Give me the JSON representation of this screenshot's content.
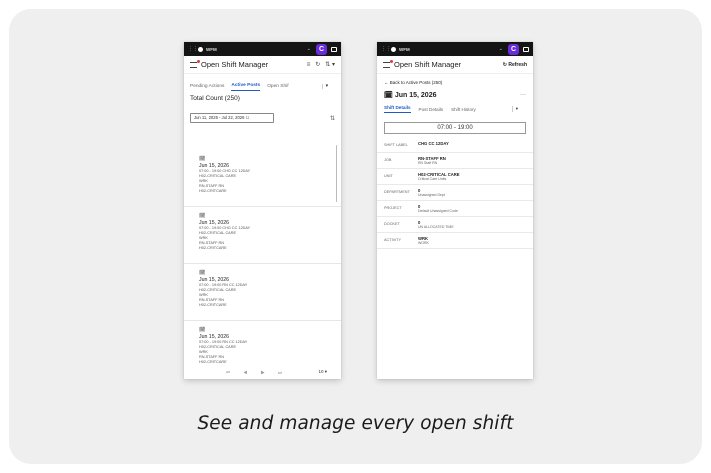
{
  "caption": "See and manage every open shift",
  "phone1": {
    "topbar": {
      "app": "WFM"
    },
    "header": {
      "title": "Open Shift Manager"
    },
    "tabs": [
      "Pending Actions",
      "Active Posts",
      "Open Shif"
    ],
    "total": "Total Count (250)",
    "date_range": "Jun 11, 2026 - Jul 22, 2026",
    "items": [
      {
        "date": "Jun 15, 2026",
        "lines": [
          "07:00 - 19:00   CHG CC 12DAY",
          "H02-CRITICAL CARE",
          "WRK",
          "RN-STAFF RN",
          "H02-CRITCARE"
        ]
      },
      {
        "date": "Jun 15, 2026",
        "lines": [
          "07:00 - 19:00   CHG CC 12DAY",
          "H02-CRITICAL CARE",
          "WRK",
          "RN-STAFF RN",
          "H02-CRITCARE"
        ]
      },
      {
        "date": "Jun 15, 2026",
        "lines": [
          "07:00 - 19:00   RN CC 12DAY",
          "H02-CRITICAL CARE",
          "WRK",
          "RN-STAFF RN",
          "H02-CRITCARE"
        ]
      },
      {
        "date": "Jun 15, 2026",
        "lines": [
          "07:00 - 19:00   RN CC 12DAY",
          "H02-CRITICAL CARE",
          "WRK",
          "RN-STAFF RN",
          "H02-CRITCARE"
        ]
      }
    ],
    "pager": {
      "count": "10 ▾"
    }
  },
  "phone2": {
    "topbar": {
      "app": "WFM"
    },
    "header": {
      "title": "Open Shift Manager",
      "refresh": "Refresh"
    },
    "back": "← Back to Active Posts (250)",
    "date": "Jun 15, 2026",
    "tabs": [
      "Shift Details",
      "Post Details",
      "Shift History"
    ],
    "time": "07:00 - 19:00",
    "rows": [
      {
        "k": "SHIFT LABEL",
        "v1": "CHG CC 12DAY",
        "v2": ""
      },
      {
        "k": "JOB",
        "v1": "RN-STAFF RN",
        "v2": "RN Staff RN"
      },
      {
        "k": "UNIT",
        "v1": "H02-CRITICAL CARE",
        "v2": "Critical Care Units"
      },
      {
        "k": "DEPARTMENT",
        "v1": "0",
        "v2": "Unassigned Dept"
      },
      {
        "k": "PROJECT",
        "v1": "0",
        "v2": "Default Unassigned Code"
      },
      {
        "k": "DOCKET",
        "v1": "0",
        "v2": "UN ALLOCATED TIME"
      },
      {
        "k": "ACTIVITY",
        "v1": "WRK",
        "v2": "WORK"
      }
    ]
  }
}
